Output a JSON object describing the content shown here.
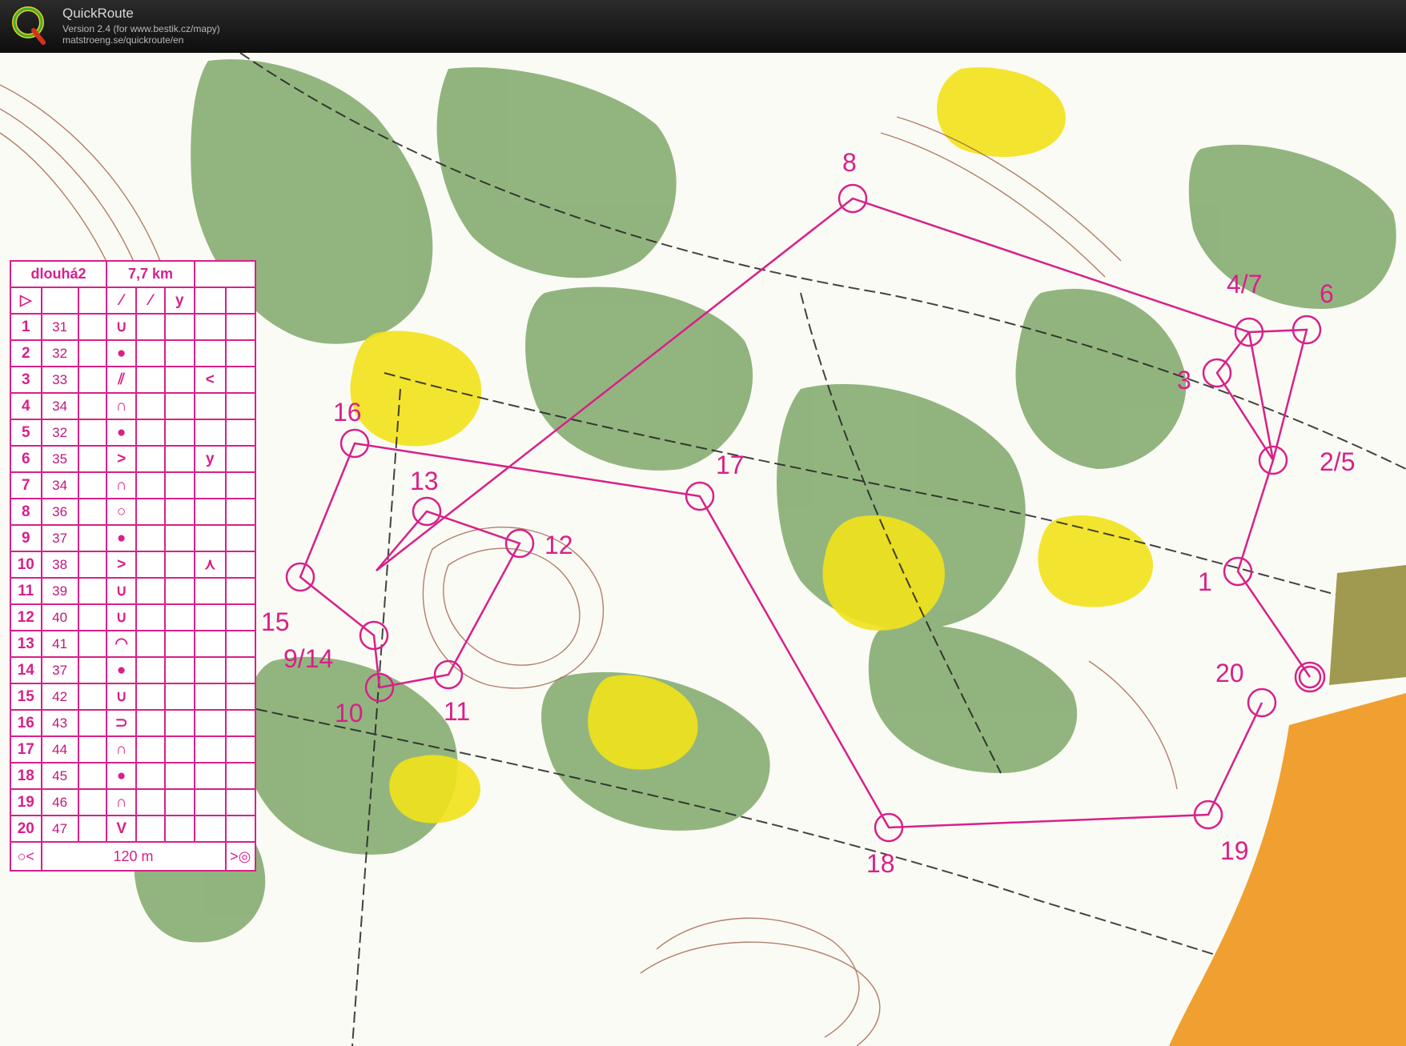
{
  "app": {
    "title": "QuickRoute",
    "version": "Version 2.4  (for www.bestik.cz/mapy)",
    "url": "matstroeng.se/quickroute/en"
  },
  "colors": {
    "course": "#d8208a",
    "forest": "#6e9a5a",
    "open": "#f2e21a",
    "contour": "#a0604a",
    "urban": "#f0a030"
  },
  "course": {
    "name": "dlouhá2",
    "length": "7,7 km",
    "controls": [
      {
        "num": "1",
        "code": "31",
        "symbol": "∪",
        "extra": ""
      },
      {
        "num": "2",
        "code": "32",
        "symbol": "●",
        "extra": ""
      },
      {
        "num": "3",
        "code": "33",
        "symbol": "⫽",
        "extra": "<"
      },
      {
        "num": "4",
        "code": "34",
        "symbol": "∩",
        "extra": ""
      },
      {
        "num": "5",
        "code": "32",
        "symbol": "●",
        "extra": ""
      },
      {
        "num": "6",
        "code": "35",
        "symbol": ">",
        "extra": "y"
      },
      {
        "num": "7",
        "code": "34",
        "symbol": "∩",
        "extra": ""
      },
      {
        "num": "8",
        "code": "36",
        "symbol": "○",
        "extra": ""
      },
      {
        "num": "9",
        "code": "37",
        "symbol": "●",
        "extra": ""
      },
      {
        "num": "10",
        "code": "38",
        "symbol": ">",
        "extra": "⋏"
      },
      {
        "num": "11",
        "code": "39",
        "symbol": "∪",
        "extra": ""
      },
      {
        "num": "12",
        "code": "40",
        "symbol": "∪",
        "extra": ""
      },
      {
        "num": "13",
        "code": "41",
        "symbol": "◠",
        "extra": ""
      },
      {
        "num": "14",
        "code": "37",
        "symbol": "●",
        "extra": ""
      },
      {
        "num": "15",
        "code": "42",
        "symbol": "∪",
        "extra": ""
      },
      {
        "num": "16",
        "code": "43",
        "symbol": "⊃",
        "extra": ""
      },
      {
        "num": "17",
        "code": "44",
        "symbol": "∩",
        "extra": ""
      },
      {
        "num": "18",
        "code": "45",
        "symbol": "●",
        "extra": ""
      },
      {
        "num": "19",
        "code": "46",
        "symbol": "∩",
        "extra": ""
      },
      {
        "num": "20",
        "code": "47",
        "symbol": "V",
        "extra": ""
      }
    ],
    "finish_distance": "120 m",
    "map_labels": [
      "8",
      "4/7",
      "6",
      "3",
      "2/5",
      "1",
      "20",
      "19",
      "18",
      "17",
      "16",
      "13",
      "12",
      "15",
      "9/14",
      "10",
      "11"
    ]
  }
}
